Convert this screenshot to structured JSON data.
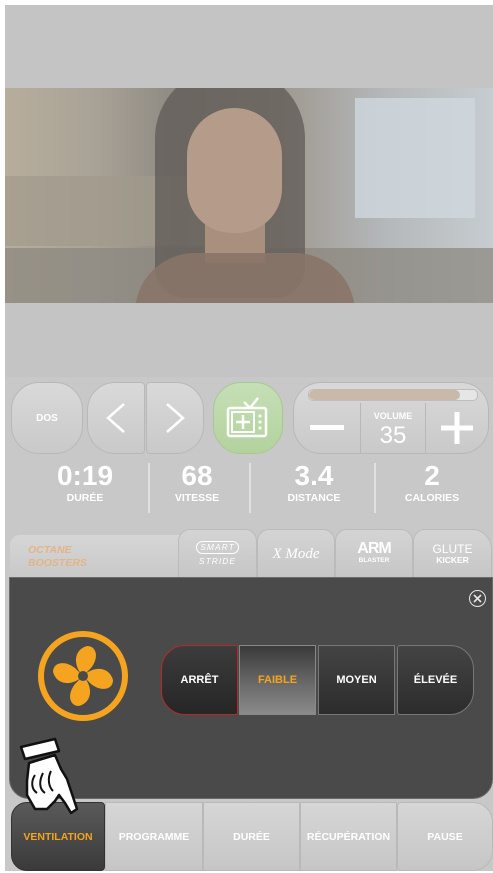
{
  "top_controls": {
    "back_label": "DOS",
    "volume_label": "VOLUME",
    "volume_value": "35",
    "volume_level": 0.9
  },
  "stats": [
    {
      "value": "0:19",
      "label": "DURÉE"
    },
    {
      "value": "68",
      "label": "VITESSE"
    },
    {
      "value": "3.4",
      "label": "DISTANCE"
    },
    {
      "value": "2",
      "label": "CALORIES"
    }
  ],
  "boosters": {
    "title_line1": "OCTANE",
    "title_line2": "BOOSTERS",
    "tabs": [
      {
        "line1": "SMART",
        "line2": "STRIDE"
      },
      {
        "line1": "X Mode",
        "line2": ""
      },
      {
        "line1": "ARM",
        "line2": "BLASTER"
      },
      {
        "line1": "GLUTE",
        "line2": "KICKER"
      }
    ]
  },
  "fan_panel": {
    "options": [
      "ARRÊT",
      "FAIBLE",
      "MOYEN",
      "ÉLEVÉE"
    ],
    "selected": "FAIBLE"
  },
  "bottom_nav": [
    "VENTILATION",
    "PROGRAMME",
    "DURÉE",
    "RÉCUPÉRATION",
    "PAUSE"
  ],
  "colors": {
    "accent_orange": "#f4a41f",
    "off_border": "#b52a2a",
    "panel_dark": "#4a4a4a"
  }
}
